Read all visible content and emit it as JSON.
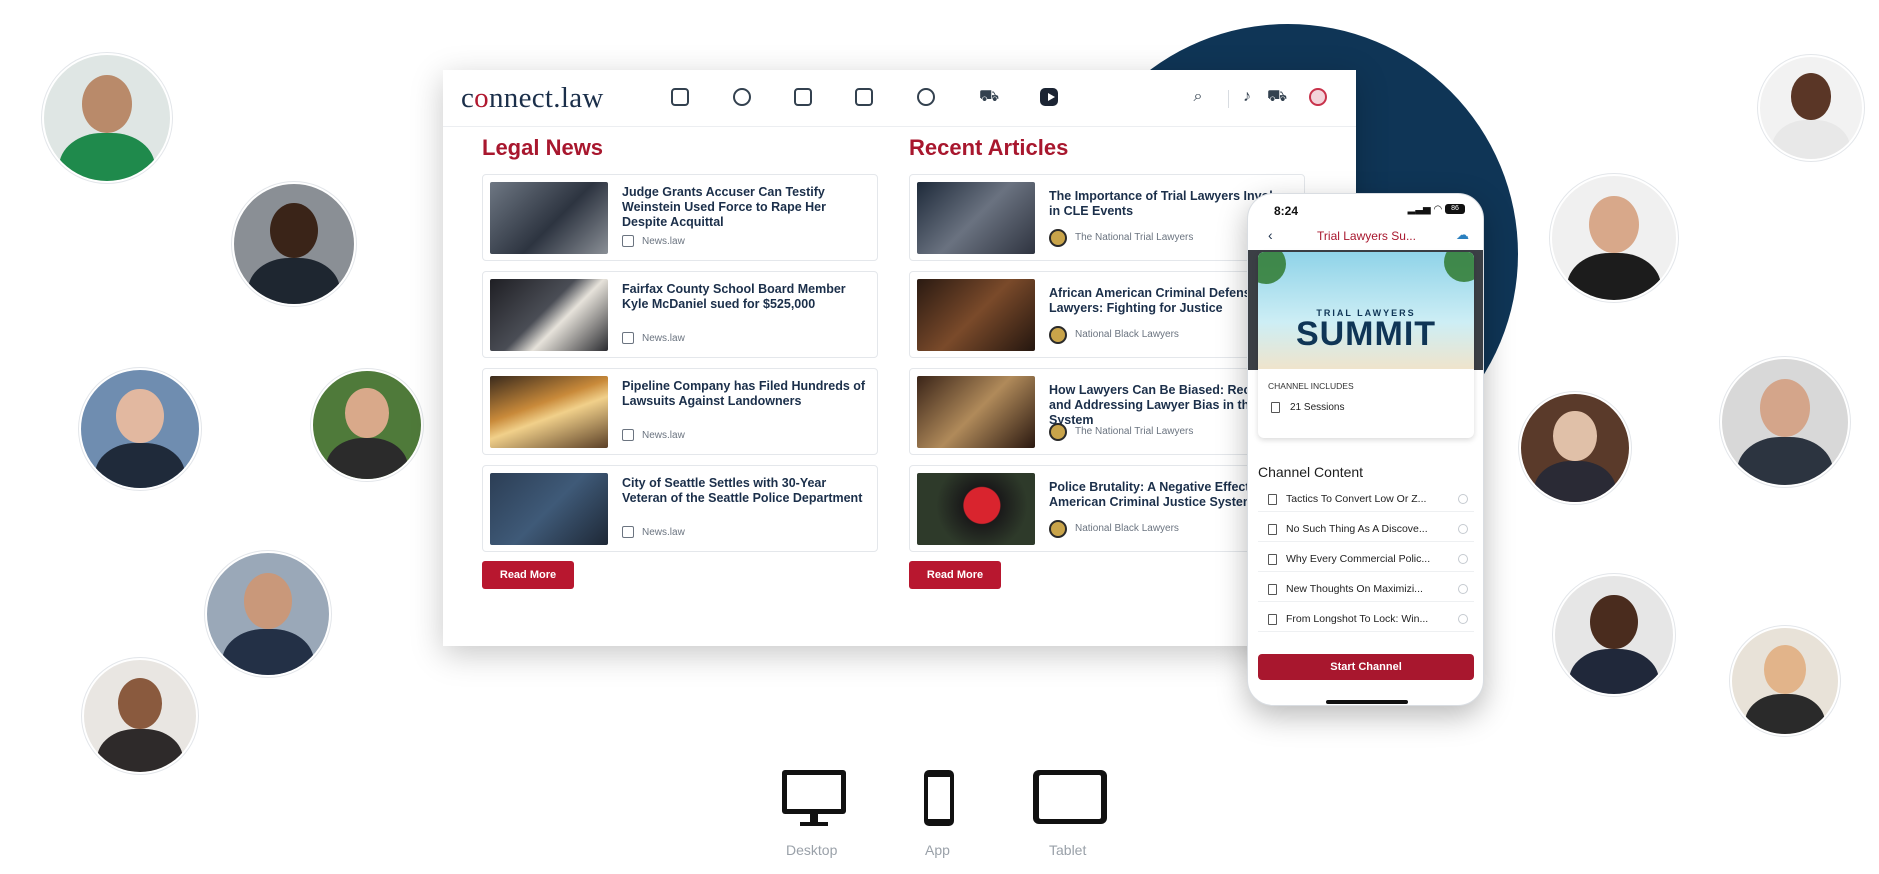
{
  "header": {
    "logo_prefix": "c",
    "logo_mid": "nnect.law",
    "nav_icons": [
      "activity-icon",
      "bug-icon",
      "calendar-icon",
      "newspaper-icon",
      "globe-icon",
      "cart-icon",
      "play-icon"
    ],
    "tools": [
      "search-icon",
      "bell-icon",
      "cart-icon",
      "profile-icon"
    ]
  },
  "legal_news": {
    "title": "Legal News",
    "items": [
      {
        "title": "Judge Grants Accuser Can Testify Weinstein Used Force to Rape Her Despite Acquittal",
        "source": "News.law"
      },
      {
        "title": "Fairfax County School Board Member Kyle McDaniel sued for $525,000",
        "source": "News.law"
      },
      {
        "title": "Pipeline Company has Filed Hundreds of Lawsuits Against Landowners",
        "source": "News.law"
      },
      {
        "title": "City of Seattle Settles with 30-Year Veteran of the Seattle Police Department",
        "source": "News.law"
      }
    ],
    "button": "Read More"
  },
  "recent_articles": {
    "title": "Recent Articles",
    "items": [
      {
        "title": "The Importance of Trial Lawyers Involv... in CLE Events",
        "source": "The National Trial Lawyers"
      },
      {
        "title": "African American Criminal Defense Lawyers: Fighting for Justice",
        "source": "National Black Lawyers"
      },
      {
        "title": "How Lawyers Can Be Biased: Recog... and Addressing Lawyer Bias in the System",
        "source": "The National Trial Lawyers"
      },
      {
        "title": "Police Brutality: A Negative Effect o... American Criminal Justice System",
        "source": "National Black Lawyers"
      }
    ],
    "button": "Read More"
  },
  "phone": {
    "time": "8:24",
    "battery": "86",
    "title": "Trial Lawyers Su...",
    "banner_small": "TRIAL LAWYERS",
    "banner_big": "SUMMIT",
    "includes": "CHANNEL INCLUDES",
    "sessions": "21 Sessions",
    "content_title": "Channel Content",
    "items": [
      "Tactics To Convert Low Or Z...",
      "No Such Thing As A Discove...",
      "Why Every Commercial Polic...",
      "New Thoughts On Maximizi...",
      "From Longshot To Lock: Win..."
    ],
    "button": "Start Channel"
  },
  "devices": [
    {
      "icon": "desktop-icon",
      "label": "Desktop"
    },
    {
      "icon": "phone-icon",
      "label": "App"
    },
    {
      "icon": "tablet-icon",
      "label": "Tablet"
    }
  ]
}
